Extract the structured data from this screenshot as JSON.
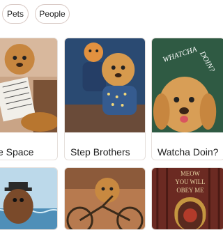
{
  "filters": {
    "chip_1": "Pets",
    "chip_2": "People"
  },
  "cards": [
    {
      "title": "e Space",
      "art": "dog-reading-newspaper"
    },
    {
      "title": "Step Brothers",
      "art": "dog-and-cat-in-sweaters"
    },
    {
      "title": "Watcha Doin?",
      "art": "dog-with-lettering",
      "art_text": {
        "word_1": "WHATCHA",
        "word_2": "DOIN?"
      }
    },
    {
      "title": "",
      "art": "dog-with-hat-at-sea"
    },
    {
      "title": "",
      "art": "dog-on-bicycle"
    },
    {
      "title": "",
      "art": "cat-portrait-poster",
      "art_text": {
        "line_1": "MEOW",
        "line_2": "YOU WILL",
        "line_3": "OBEY ME"
      }
    }
  ],
  "colors": {
    "chip_border": "#d8c9c4",
    "card_border": "#e6e0dc",
    "green_bg": "#2f5a43",
    "maroon_bg": "#6b2a22"
  }
}
